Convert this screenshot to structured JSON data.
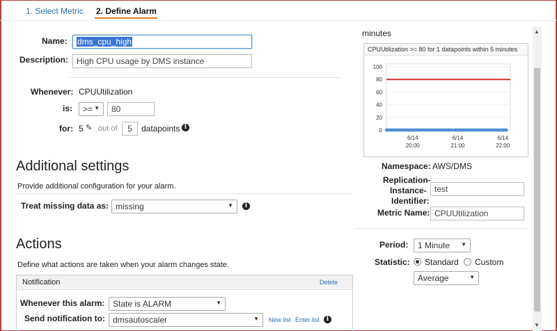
{
  "tabs": [
    {
      "label": "1. Select Metric"
    },
    {
      "label": "2. Define Alarm"
    }
  ],
  "form": {
    "name_label": "Name:",
    "name_value": "dms_cpu_high",
    "description_label": "Description:",
    "description_value": "High CPU usage by DMS instance",
    "whenever_label": "Whenever:",
    "whenever_value": "CPUUtilization",
    "is_label": "is:",
    "operator": ">=",
    "threshold": "80",
    "for_label": "for:",
    "for_value": "5",
    "out_of": "out of",
    "datapoints_total": "5",
    "datapoints_label": "datapoints"
  },
  "additional": {
    "heading": "Additional settings",
    "desc": "Provide additional configuration for your alarm.",
    "missing_label": "Treat missing data as:",
    "missing_value": "missing"
  },
  "actions": {
    "heading": "Actions",
    "desc": "Define what actions are taken when your alarm changes state.",
    "notification_title": "Notification",
    "delete_label": "Delete",
    "whenever_alarm_label": "Whenever this alarm:",
    "whenever_alarm_value": "State is ALARM",
    "send_label": "Send notification to:",
    "send_value": "dmsautoscaler",
    "new_list": "New list",
    "enter_list": "Enter list"
  },
  "right": {
    "minutes_label": "minutes",
    "namespace_label": "Namespace:",
    "namespace_value": "AWS/DMS",
    "rep_label_1": "Replication-",
    "rep_label_2": "Instance-",
    "rep_label_3": "Identifier:",
    "rep_value": "test",
    "metric_label": "Metric Name:",
    "metric_value": "CPUUtilization",
    "period_label": "Period:",
    "period_value": "1 Minute",
    "statistic_label": "Statistic:",
    "standard_label": "Standard",
    "custom_label": "Custom",
    "statistic_value": "Average"
  },
  "chart_data": {
    "type": "line",
    "title": "CPUUtilization >= 80 for 1 datapoints within 5 minutes",
    "ylim": [
      0,
      100
    ],
    "yticks": [
      "100",
      "80",
      "60",
      "40",
      "20",
      "0"
    ],
    "xticks": [
      {
        "date": "6/14",
        "time": "20:00"
      },
      {
        "date": "6/14",
        "time": "21:00"
      },
      {
        "date": "6/14",
        "time": "22:00"
      }
    ],
    "threshold": 80,
    "threshold_color": "#d0302c",
    "series_color": "#4f8fd6",
    "series": [
      {
        "segments": [
          [
            "19:25",
            "20:30"
          ],
          [
            "20:32",
            "20:52"
          ],
          [
            "20:55",
            "21:55"
          ],
          [
            "21:57",
            "22:05"
          ]
        ],
        "value": 0
      }
    ]
  },
  "colors": {
    "accent": "#e07b1a",
    "link": "#2d6fb0"
  },
  "icons": {
    "info": "info-icon",
    "pencil": "pencil-icon"
  }
}
